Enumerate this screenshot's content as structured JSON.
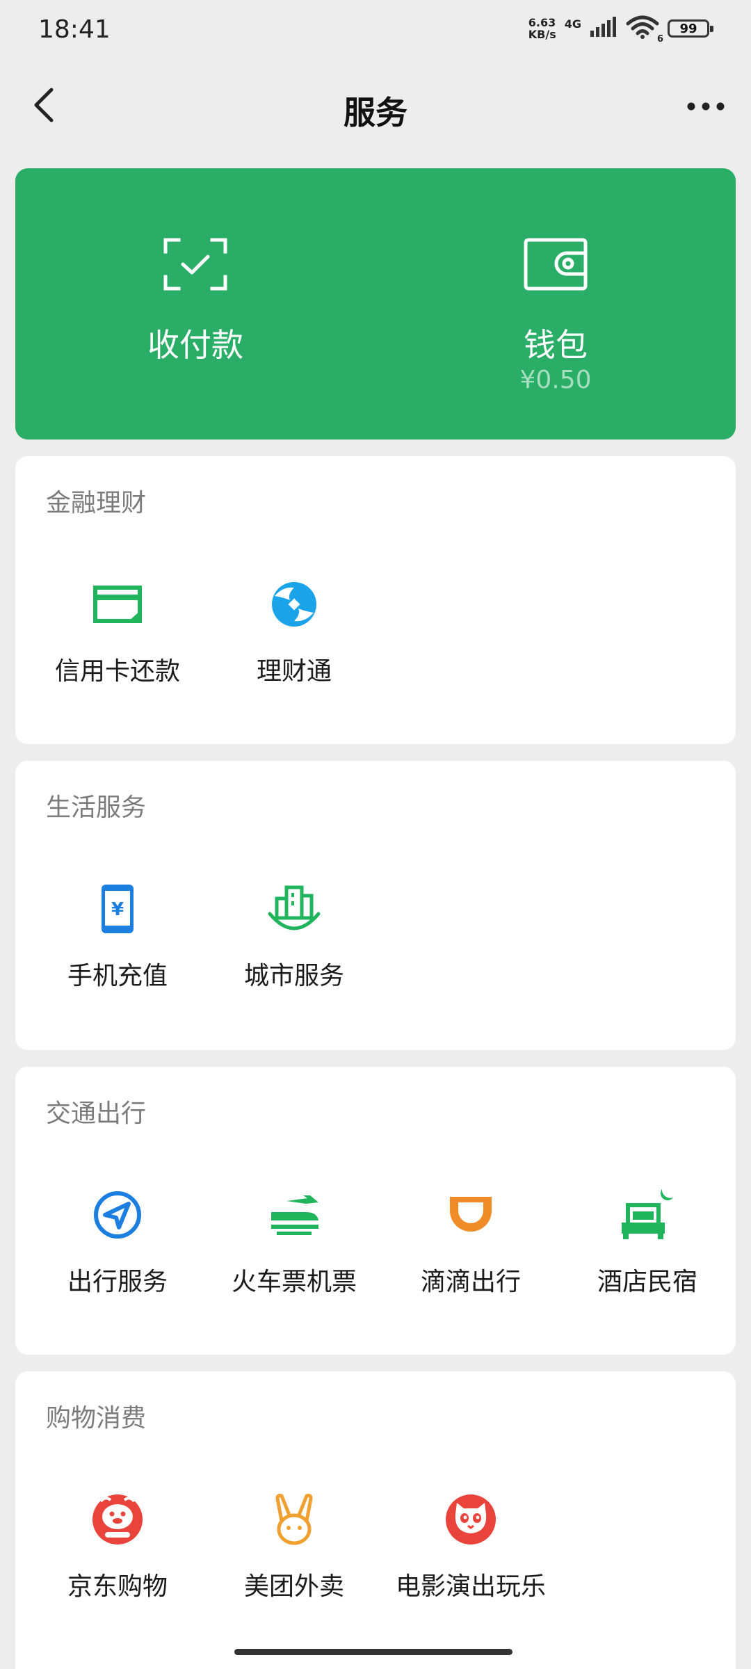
{
  "status": {
    "time": "18:41",
    "speed_value": "6.63",
    "speed_unit": "KB/s",
    "network": "4G",
    "battery": "99",
    "wifi_level": "6"
  },
  "header": {
    "title": "服务"
  },
  "hero": {
    "pay": {
      "label": "收付款",
      "icon": "scan-pay-icon"
    },
    "wallet": {
      "label": "钱包",
      "balance": "¥0.50",
      "icon": "wallet-icon"
    }
  },
  "sections": [
    {
      "title": "金融理财",
      "items": [
        {
          "label": "信用卡还款",
          "icon": "credit-card-icon",
          "color": "#20b45c"
        },
        {
          "label": "理财通",
          "icon": "licaitong-icon",
          "color": "#1aa3e8"
        }
      ]
    },
    {
      "title": "生活服务",
      "items": [
        {
          "label": "手机充值",
          "icon": "phone-topup-icon",
          "color": "#1c7fe0"
        },
        {
          "label": "城市服务",
          "icon": "city-service-icon",
          "color": "#20b45c"
        }
      ]
    },
    {
      "title": "交通出行",
      "items": [
        {
          "label": "出行服务",
          "icon": "navigation-icon",
          "color": "#1c7fe0"
        },
        {
          "label": "火车票机票",
          "icon": "train-plane-icon",
          "color": "#20b45c"
        },
        {
          "label": "滴滴出行",
          "icon": "didi-icon",
          "color": "#f08c28"
        },
        {
          "label": "酒店民宿",
          "icon": "hotel-icon",
          "color": "#20b45c"
        }
      ]
    },
    {
      "title": "购物消费",
      "items": [
        {
          "label": "京东购物",
          "icon": "jd-icon",
          "color": "#e8443c"
        },
        {
          "label": "美团外卖",
          "icon": "meituan-icon",
          "color": "#f0a030"
        },
        {
          "label": "电影演出玩乐",
          "icon": "maoyan-icon",
          "color": "#e8443c"
        }
      ]
    }
  ]
}
